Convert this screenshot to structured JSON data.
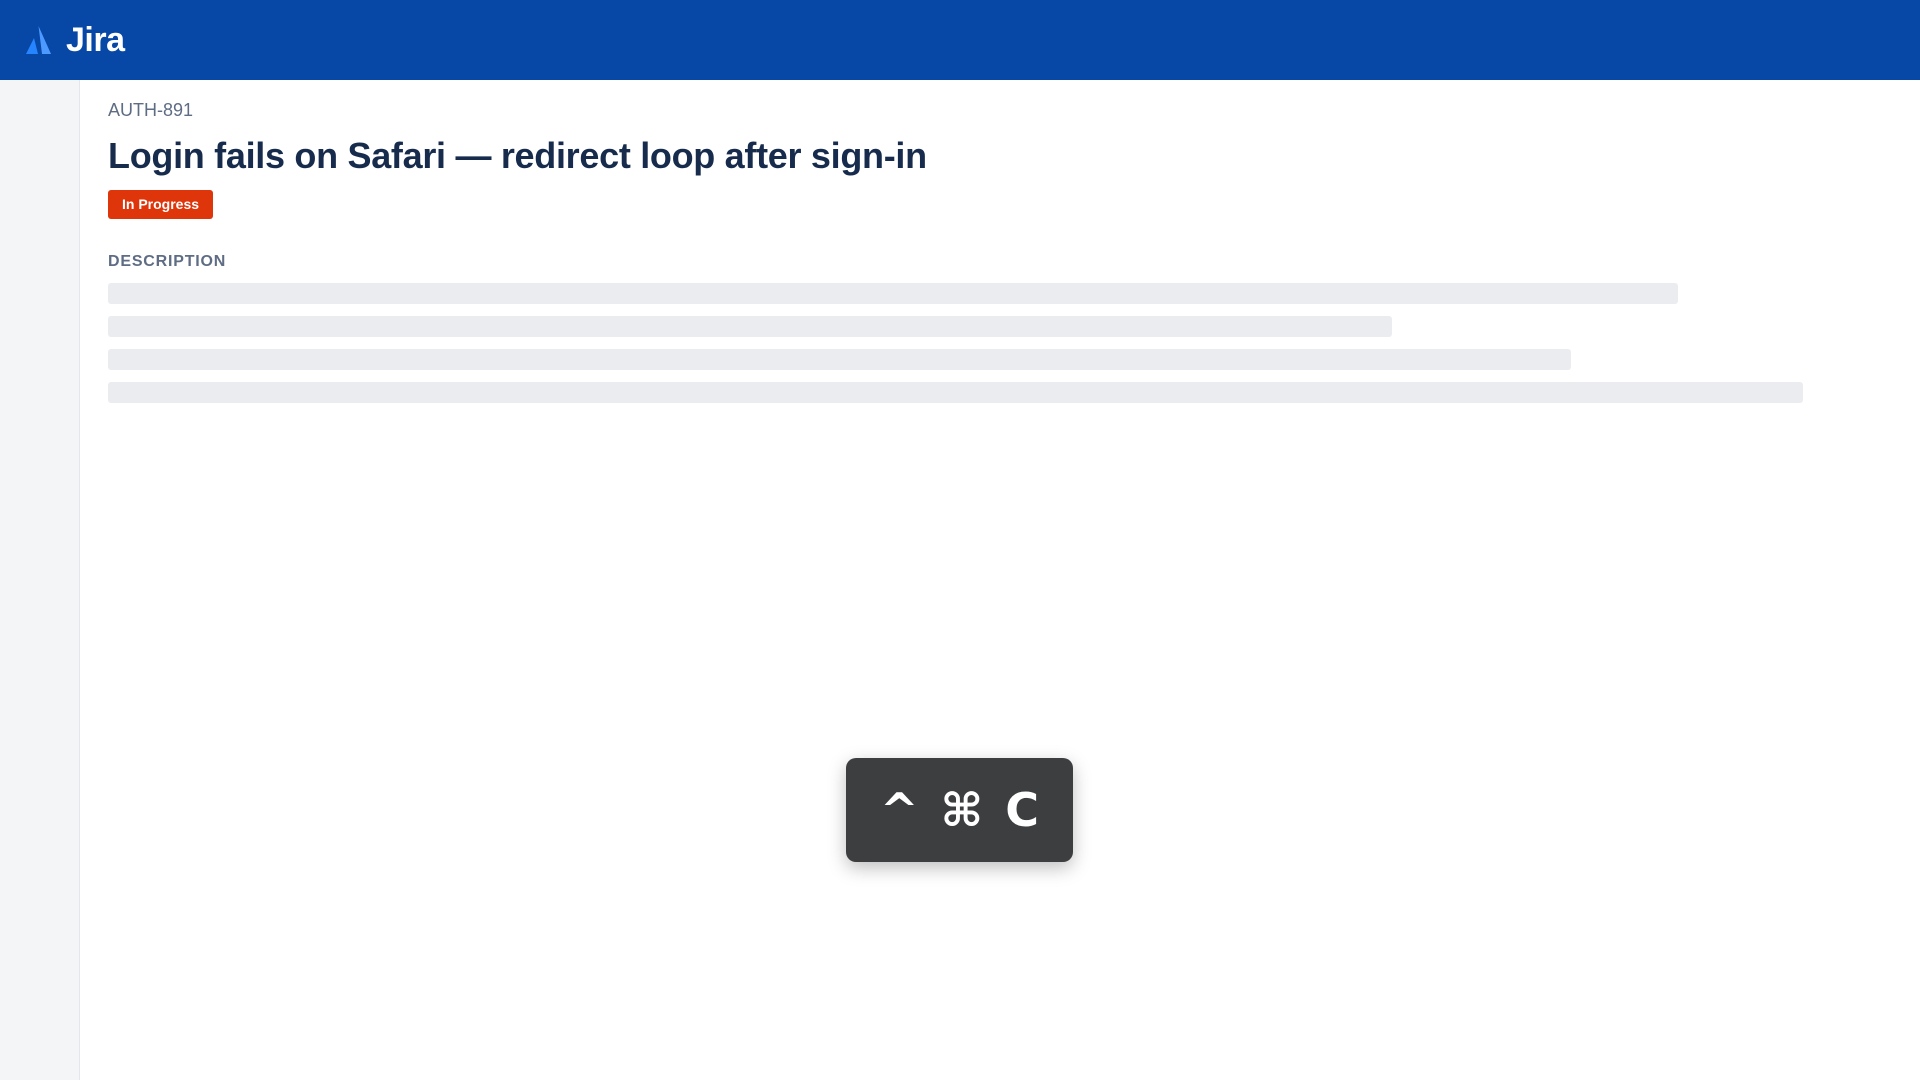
{
  "app": {
    "name": "Jira",
    "brand_color": "#0747a6",
    "logo_icon": "atlassian-logo-icon"
  },
  "issue": {
    "key": "AUTH-891",
    "title": "Login fails on Safari — redirect loop after sign-in",
    "status": "In Progress",
    "status_color": "#de350b"
  },
  "description": {
    "label": "DESCRIPTION",
    "state": "loading"
  },
  "keyboard_shortcut": {
    "keys": [
      "^",
      "⌘",
      "C"
    ]
  }
}
